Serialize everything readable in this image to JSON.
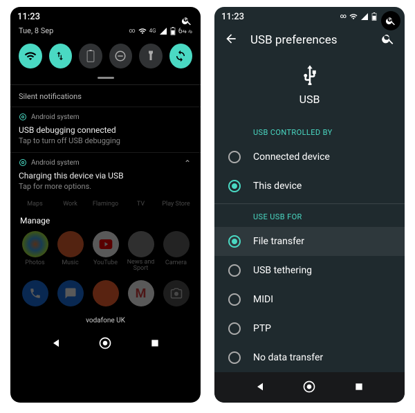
{
  "global": {
    "time": "11:23"
  },
  "left": {
    "date": "Tue, 8 Sep",
    "battery": "64%",
    "signal_label": "4G",
    "section_silent": "Silent notifications",
    "notif1": {
      "source": "Android system",
      "title": "USB debugging connected",
      "body": "Tap to turn off USB debugging"
    },
    "notif2": {
      "source": "Android system",
      "title": "Charging this device via USB",
      "body": "Tap for more options."
    },
    "manage": "Manage",
    "apps_row1": [
      "Maps",
      "Work",
      "Flamingo",
      "TV",
      "Play Store"
    ],
    "apps_row2": [
      "Photos",
      "Music",
      "YouTube",
      "News and Sport",
      "Camera"
    ],
    "carrier": "vodafone UK"
  },
  "right": {
    "title": "USB preferences",
    "hero": "USB",
    "group1": "USB CONTROLLED BY",
    "g1_items": [
      {
        "label": "Connected device",
        "selected": false
      },
      {
        "label": "This device",
        "selected": true
      }
    ],
    "group2": "USE USB FOR",
    "g2_items": [
      {
        "label": "File transfer",
        "selected": true
      },
      {
        "label": "USB tethering",
        "selected": false
      },
      {
        "label": "MIDI",
        "selected": false
      },
      {
        "label": "PTP",
        "selected": false
      },
      {
        "label": "No data transfer",
        "selected": false
      }
    ]
  }
}
